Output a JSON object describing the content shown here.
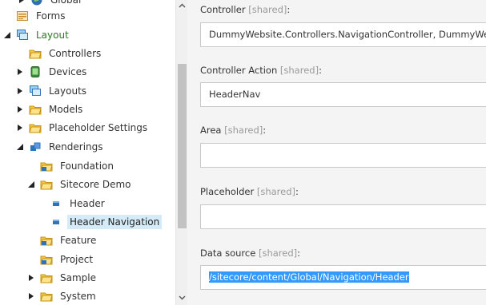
{
  "tree": {
    "top_partial": "Global",
    "forms": "Forms",
    "layout": "Layout",
    "controllers": "Controllers",
    "devices": "Devices",
    "layouts": "Layouts",
    "models": "Models",
    "placeholder_settings": "Placeholder Settings",
    "renderings": "Renderings",
    "foundation": "Foundation",
    "sitecore_demo": "Sitecore Demo",
    "header": "Header",
    "header_navigation": "Header Navigation",
    "feature": "Feature",
    "project": "Project",
    "sample": "Sample",
    "system": "System"
  },
  "form": {
    "shared_tag": "[shared]",
    "controller": {
      "label": "Controller",
      "value": "DummyWebsite.Controllers.NavigationController, DummyWebsite"
    },
    "controller_action": {
      "label": "Controller Action",
      "value": "HeaderNav"
    },
    "area": {
      "label": "Area",
      "value": ""
    },
    "placeholder": {
      "label": "Placeholder",
      "value": ""
    },
    "data_source": {
      "label": "Data source",
      "value": "/sitecore/content/Global/Navigation/Header"
    },
    "colon": ":"
  },
  "colors": {
    "selection": "#d6ebf8",
    "text_highlight": "#3399ff",
    "layout_label": "#2a7a1f",
    "form_background": "#f4f4f4"
  }
}
